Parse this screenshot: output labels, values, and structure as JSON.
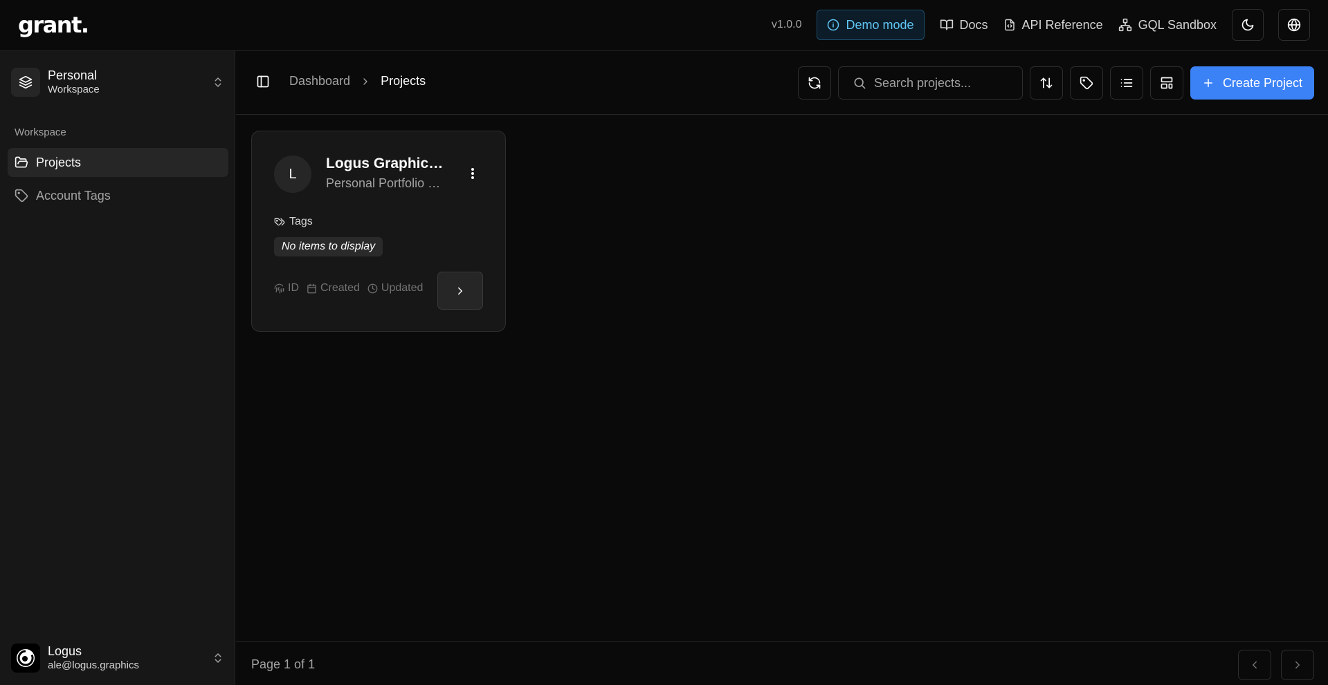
{
  "app": {
    "logo": "grant."
  },
  "topbar": {
    "version": "v1.0.0",
    "demo_mode": "Demo mode",
    "links": [
      "Docs",
      "API Reference",
      "GQL Sandbox"
    ]
  },
  "sidebar": {
    "workspace_switcher": {
      "name": "Personal",
      "subtitle": "Workspace"
    },
    "section_label": "Workspace",
    "items": [
      {
        "label": "Projects",
        "icon": "folder-open-icon",
        "active": true
      },
      {
        "label": "Account Tags",
        "icon": "tag-icon",
        "active": false
      }
    ],
    "user": {
      "name": "Logus",
      "email": "ale@logus.graphics"
    }
  },
  "header": {
    "breadcrumb": [
      "Dashboard",
      "Projects"
    ],
    "search_placeholder": "Search projects...",
    "create_label": "Create Project"
  },
  "projects": [
    {
      "initial": "L",
      "title": "Logus Graphics Portfolio",
      "description": "Personal Portfolio website",
      "tags_label": "Tags",
      "tags_empty": "No items to display",
      "meta": [
        "ID",
        "Created",
        "Updated"
      ]
    }
  ],
  "footer": {
    "page_text": "Page 1 of 1"
  },
  "colors": {
    "accent": "#3b82f6",
    "demo": "#60c6f5",
    "background": "#0a0a0a",
    "sidebar": "#171717"
  }
}
